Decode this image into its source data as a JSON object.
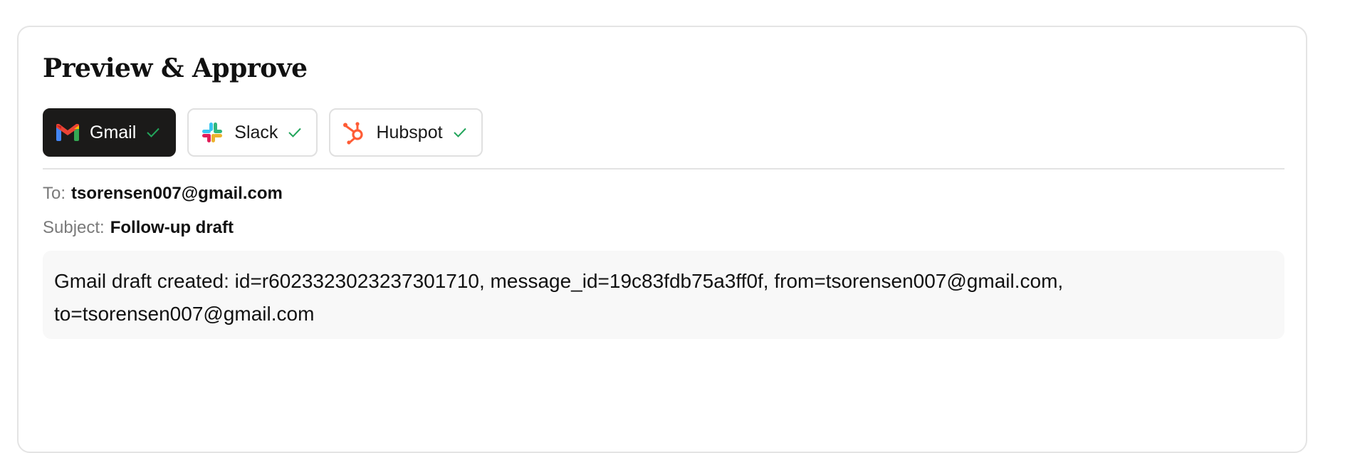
{
  "panel": {
    "title": "Preview & Approve"
  },
  "tabs": [
    {
      "label": "Gmail",
      "icon": "gmail-logo-icon",
      "status": "check-icon",
      "active": true
    },
    {
      "label": "Slack",
      "icon": "slack-logo-icon",
      "status": "check-icon",
      "active": false
    },
    {
      "label": "Hubspot",
      "icon": "hubspot-logo-icon",
      "status": "check-icon",
      "active": false
    }
  ],
  "email": {
    "to_label": "To:",
    "to_value": "tsorensen007@gmail.com",
    "subject_label": "Subject:",
    "subject_value": "Follow-up draft",
    "body": "Gmail draft created: id=r6023323023237301710, message_id=19c83fdb75a3ff0f, from=tsorensen007@gmail.com, to=tsorensen007@gmail.com"
  },
  "colors": {
    "active_tab_bg": "#1b1a19",
    "check_green": "#22a55b",
    "hubspot_orange": "#ff5c35"
  }
}
